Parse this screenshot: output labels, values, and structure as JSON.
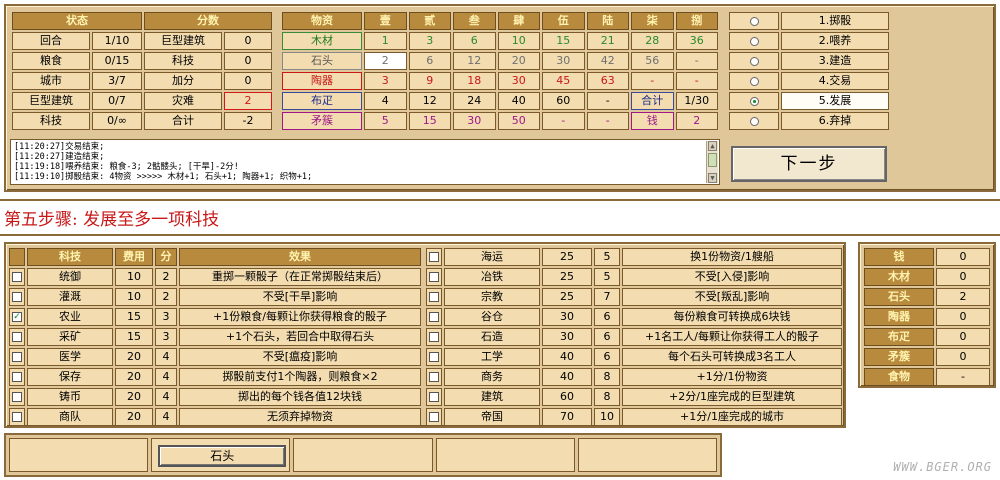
{
  "status": {
    "headers": [
      "状态",
      "分数"
    ],
    "rows": [
      {
        "label": "回合",
        "value": "1/10",
        "slabel": "巨型建筑",
        "svalue": "0",
        "alert": false
      },
      {
        "label": "粮食",
        "value": "0/15",
        "slabel": "科技",
        "svalue": "0",
        "alert": false
      },
      {
        "label": "城市",
        "value": "3/7",
        "slabel": "加分",
        "svalue": "0",
        "alert": false
      },
      {
        "label": "巨型建筑",
        "value": "0/7",
        "slabel": "灾难",
        "svalue": "2",
        "alert": true
      },
      {
        "label": "科技",
        "value": "0/∞",
        "slabel": "合计",
        "svalue": "-2",
        "alert": false
      }
    ]
  },
  "goods": {
    "headers": [
      "物资",
      "壹",
      "贰",
      "叁",
      "肆",
      "伍",
      "陆",
      "柒",
      "捌"
    ],
    "rows": [
      {
        "name": "木材",
        "color": "green",
        "cells": [
          "1",
          "3",
          "6",
          "10",
          "15",
          "21",
          "28",
          "36"
        ]
      },
      {
        "name": "石头",
        "color": "gray",
        "cells": [
          "2",
          "6",
          "12",
          "20",
          "30",
          "42",
          "56",
          "-"
        ]
      },
      {
        "name": "陶器",
        "color": "red",
        "cells": [
          "3",
          "9",
          "18",
          "30",
          "45",
          "63",
          "-",
          "-"
        ]
      },
      {
        "name": "布疋",
        "color": "blue",
        "cells": [
          "4",
          "12",
          "24",
          "40",
          "60",
          "-",
          "合计",
          "1/30"
        ]
      },
      {
        "name": "矛簇",
        "color": "purple",
        "cells": [
          "5",
          "15",
          "30",
          "50",
          "-",
          "-",
          "钱",
          "2"
        ]
      }
    ]
  },
  "phases": {
    "items": [
      {
        "label": "1.掷骰",
        "selected": false
      },
      {
        "label": "2.喂养",
        "selected": false
      },
      {
        "label": "3.建造",
        "selected": false
      },
      {
        "label": "4.交易",
        "selected": false
      },
      {
        "label": "5.发展",
        "selected": true
      },
      {
        "label": "6.弃掉",
        "selected": false
      }
    ]
  },
  "log": {
    "lines": [
      "[11:20:27]交易结束;",
      "[11:20:27]建造结束;",
      "[11:19:18]喂养结束: 粮食-3; 2骷髅头; [干旱]-2分!",
      "[11:19:10]掷骰结束: 4物资 >>>>> 木材+1; 石头+1; 陶器+1; 织物+1;"
    ]
  },
  "next_button": "下一步",
  "step_title": "第五步骤: 发展至多一项科技",
  "tech": {
    "headers": [
      "科技",
      "费用",
      "分",
      "效果"
    ],
    "left": [
      {
        "name": "统御",
        "cost": "10",
        "pts": "2",
        "effect": "重掷一颗骰子（在正常掷骰结束后）",
        "checked": false
      },
      {
        "name": "灌溉",
        "cost": "10",
        "pts": "2",
        "effect": "不受[干旱]影响",
        "checked": false
      },
      {
        "name": "农业",
        "cost": "15",
        "pts": "3",
        "effect": "+1份粮食/每颗让你获得粮食的骰子",
        "checked": true
      },
      {
        "name": "采矿",
        "cost": "15",
        "pts": "3",
        "effect": "+1个石头，若回合中取得石头",
        "checked": false
      },
      {
        "name": "医学",
        "cost": "20",
        "pts": "4",
        "effect": "不受[瘟疫]影响",
        "checked": false
      },
      {
        "name": "保存",
        "cost": "20",
        "pts": "4",
        "effect": "掷骰前支付1个陶器，则粮食×2",
        "checked": false
      },
      {
        "name": "铸币",
        "cost": "20",
        "pts": "4",
        "effect": "掷出的每个钱各值12块钱",
        "checked": false
      },
      {
        "name": "商队",
        "cost": "20",
        "pts": "4",
        "effect": "无须弃掉物资",
        "checked": false
      }
    ],
    "right": [
      {
        "name": "海运",
        "cost": "25",
        "pts": "5",
        "effect": "换1份物资/1艘船",
        "checked": false
      },
      {
        "name": "冶铁",
        "cost": "25",
        "pts": "5",
        "effect": "不受[入侵]影响",
        "checked": false
      },
      {
        "name": "宗教",
        "cost": "25",
        "pts": "7",
        "effect": "不受[叛乱]影响",
        "checked": false
      },
      {
        "name": "谷仓",
        "cost": "30",
        "pts": "6",
        "effect": "每份粮食可转换成6块钱",
        "checked": false
      },
      {
        "name": "石造",
        "cost": "30",
        "pts": "6",
        "effect": "+1名工人/每颗让你获得工人的骰子",
        "checked": false
      },
      {
        "name": "工学",
        "cost": "40",
        "pts": "6",
        "effect": "每个石头可转换成3名工人",
        "checked": false
      },
      {
        "name": "商务",
        "cost": "40",
        "pts": "8",
        "effect": "+1分/1份物资",
        "checked": false
      },
      {
        "name": "建筑",
        "cost": "60",
        "pts": "8",
        "effect": "+2分/1座完成的巨型建筑",
        "checked": false
      },
      {
        "name": "帝国",
        "cost": "70",
        "pts": "10",
        "effect": "+1分/1座完成的城市",
        "checked": false
      }
    ]
  },
  "inventory": {
    "rows": [
      {
        "label": "钱",
        "value": "0"
      },
      {
        "label": "木材",
        "value": "0"
      },
      {
        "label": "石头",
        "value": "2"
      },
      {
        "label": "陶器",
        "value": "0"
      },
      {
        "label": "布疋",
        "value": "0"
      },
      {
        "label": "矛簇",
        "value": "0"
      },
      {
        "label": "食物",
        "value": "-"
      }
    ]
  },
  "bottom": {
    "stone_button": "石头"
  },
  "watermark": "WWW.BGER.ORG"
}
